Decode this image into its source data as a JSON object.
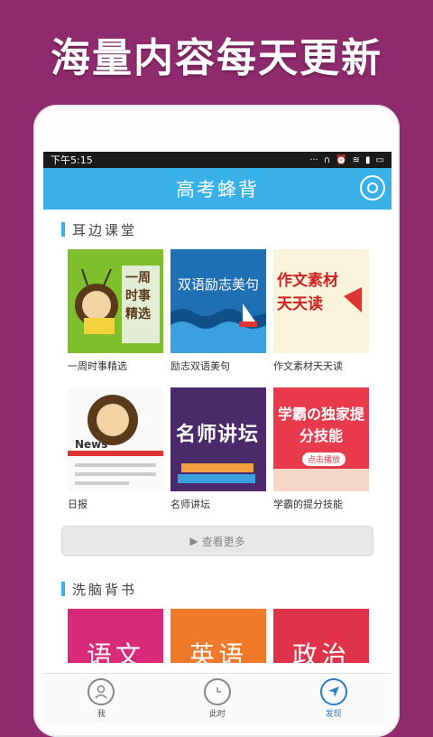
{
  "promo": {
    "headline": "海量内容每天更新"
  },
  "status": {
    "time": "下午5:15",
    "icons": [
      "dots-icon",
      "headphones-icon",
      "alarm-icon",
      "wifi-icon",
      "signal-icon",
      "battery-icon"
    ]
  },
  "app": {
    "title": "高考蜂背"
  },
  "sections": [
    {
      "title": "耳边课堂"
    },
    {
      "title": "洗脑背书"
    }
  ],
  "courses": [
    {
      "caption": "一周时事精选",
      "thumb_text": "一周时事精选"
    },
    {
      "caption": "励志双语美句",
      "thumb_text": "双语励志美句"
    },
    {
      "caption": "作文素材天天读",
      "thumb_text": "作文素材天天读"
    },
    {
      "caption": "日报",
      "thumb_text": "News"
    },
    {
      "caption": "名师讲坛",
      "thumb_text": "名师讲坛"
    },
    {
      "caption": "学霸的提分技能",
      "thumb_text": "学霸の独家提分技能",
      "thumb_sub": "点击播放"
    }
  ],
  "more_label": "查看更多",
  "subjects": [
    {
      "label": "语文",
      "color": "#d92a7a"
    },
    {
      "label": "英语",
      "color": "#f07a2a"
    },
    {
      "label": "政治",
      "color": "#e0334a"
    }
  ],
  "tabs": [
    {
      "label": "我",
      "icon": "user-icon"
    },
    {
      "label": "此时",
      "icon": "clock-icon"
    },
    {
      "label": "发现",
      "icon": "compass-icon"
    }
  ]
}
